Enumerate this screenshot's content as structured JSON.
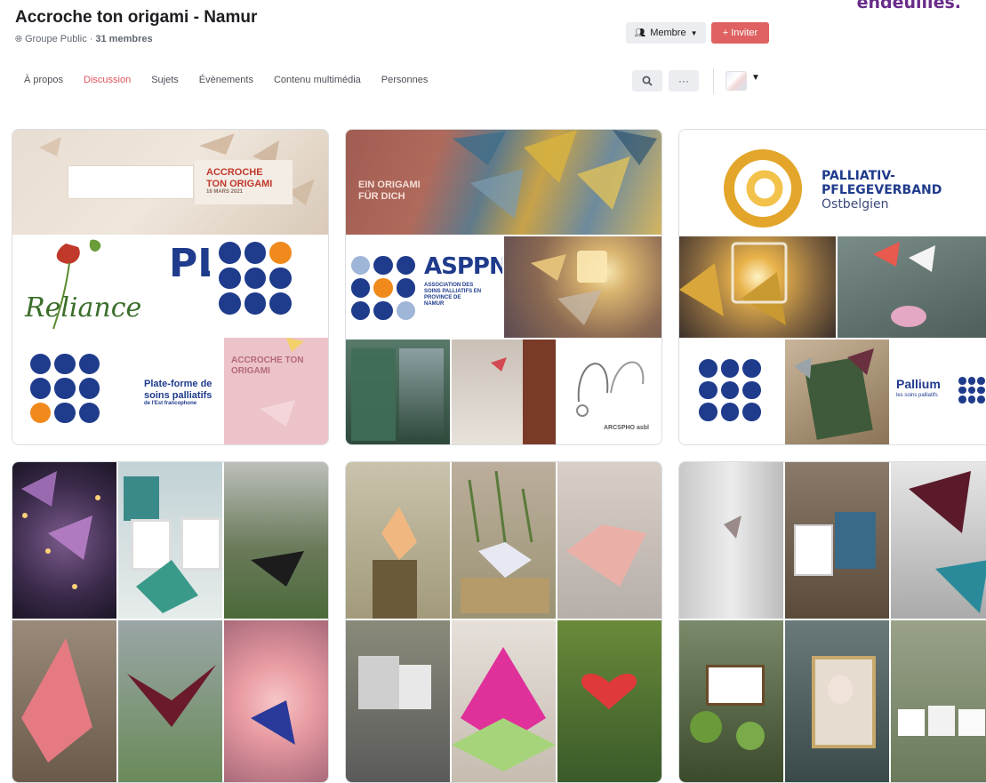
{
  "corner_text": "endeuillés.",
  "group": {
    "title": "Accroche ton origami - Namur",
    "privacy": "Groupe Public",
    "members": "31 membres",
    "separator": "·"
  },
  "actions": {
    "member_label": "Membre",
    "invite_label": "Inviter"
  },
  "tabs": [
    {
      "label": "À propos",
      "active": false
    },
    {
      "label": "Discussion",
      "active": true
    },
    {
      "label": "Sujets",
      "active": false
    },
    {
      "label": "Évènements",
      "active": false
    },
    {
      "label": "Contenu multimédia",
      "active": false
    },
    {
      "label": "Personnes",
      "active": false
    }
  ],
  "icons": {
    "search": "magnifier",
    "more": "ellipsis",
    "caret": "caret-down",
    "globe": "globe",
    "members": "group-people",
    "plus": "plus"
  },
  "colors": {
    "accent": "#e0545c",
    "invite_bg": "#e06161",
    "button_bg": "#ebedf0",
    "corner_text": "#6a2c8a",
    "navy": "#1f3b8c",
    "orange": "#f08a1c"
  },
  "posts": {
    "p1": {
      "banner_line1": "ACCROCHE",
      "banner_line2": "TON ORIGAMI",
      "banner_date": "16 MARS 2021",
      "reliance": "Reliance",
      "pl": "PL",
      "plateforme_line1": "Plate-forme de",
      "plateforme_line2": "soins palliatifs",
      "plateforme_line3": "de l'Est francophone",
      "pink_line1": "ACCROCHE TON",
      "pink_line2": "ORIGAMI"
    },
    "p2": {
      "banner_line1": "EIN ORIGAMI",
      "banner_line2": "FÜR DICH",
      "asppn": "ASPPN",
      "asppn_line1": "ASSOCIATION DES",
      "asppn_line2": "SOINS PALLIATIFS EN",
      "asppn_line3": "PROVINCE DE",
      "asppn_line4": "NAMUR",
      "arcspho": "ARCSPHO asbl"
    },
    "p3": {
      "org_line1": "PALLIATIV-",
      "org_line2": "PFLEGEVERBAND",
      "org_line3": "Ostbelgien",
      "pallium": "Pallium",
      "pallium_sub": "les soins palliatifs"
    }
  }
}
